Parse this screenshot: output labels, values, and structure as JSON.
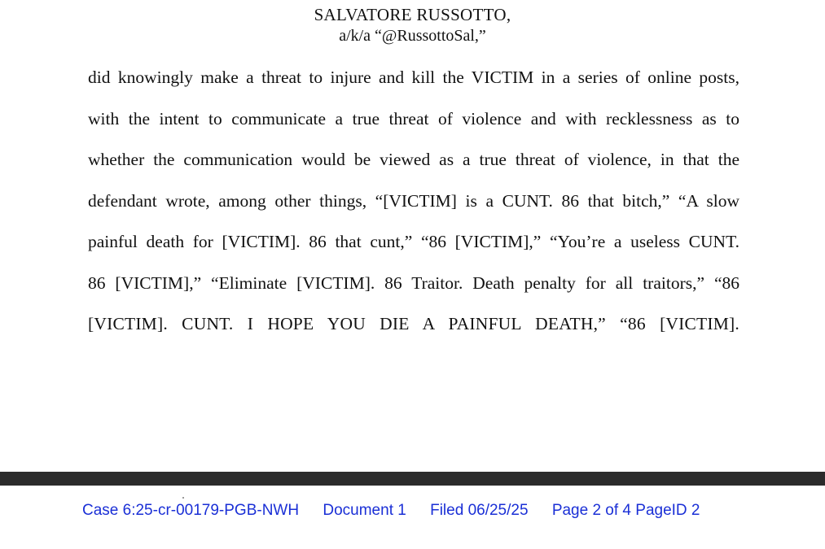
{
  "document": {
    "caption": {
      "name": "SALVATORE RUSSOTTO,",
      "aka": "a/k/a “@RussottoSal,”"
    },
    "body_lines": [
      "did knowingly make a threat to injure and kill the VICTIM in a series of online posts,",
      "with the intent to communicate a true threat of violence and with recklessness as to",
      "whether the communication would be viewed as a true threat of violence, in that the",
      "defendant wrote, among other things, “[VICTIM] is a CUNT. 86 that bitch,” “A slow",
      "painful death for [VICTIM]. 86 that cunt,” “86 [VICTIM],” “You’re a useless CUNT.",
      "86 [VICTIM],” “Eliminate [VICTIM]. 86 Traitor. Death penalty for all traitors,” “86",
      "[VICTIM]. CUNT. I HOPE YOU DIE A PAINFUL DEATH,” “86 [VICTIM]."
    ]
  },
  "footer": {
    "case": "Case 6:25-cr-00179-PGB-NWH",
    "document": "Document 1",
    "filed": "Filed 06/25/25",
    "page": "Page 2 of 4 PageID 2"
  },
  "colors": {
    "footer_link": "#1a2fd6",
    "divider": "#2b2b2b",
    "text": "#111111"
  }
}
